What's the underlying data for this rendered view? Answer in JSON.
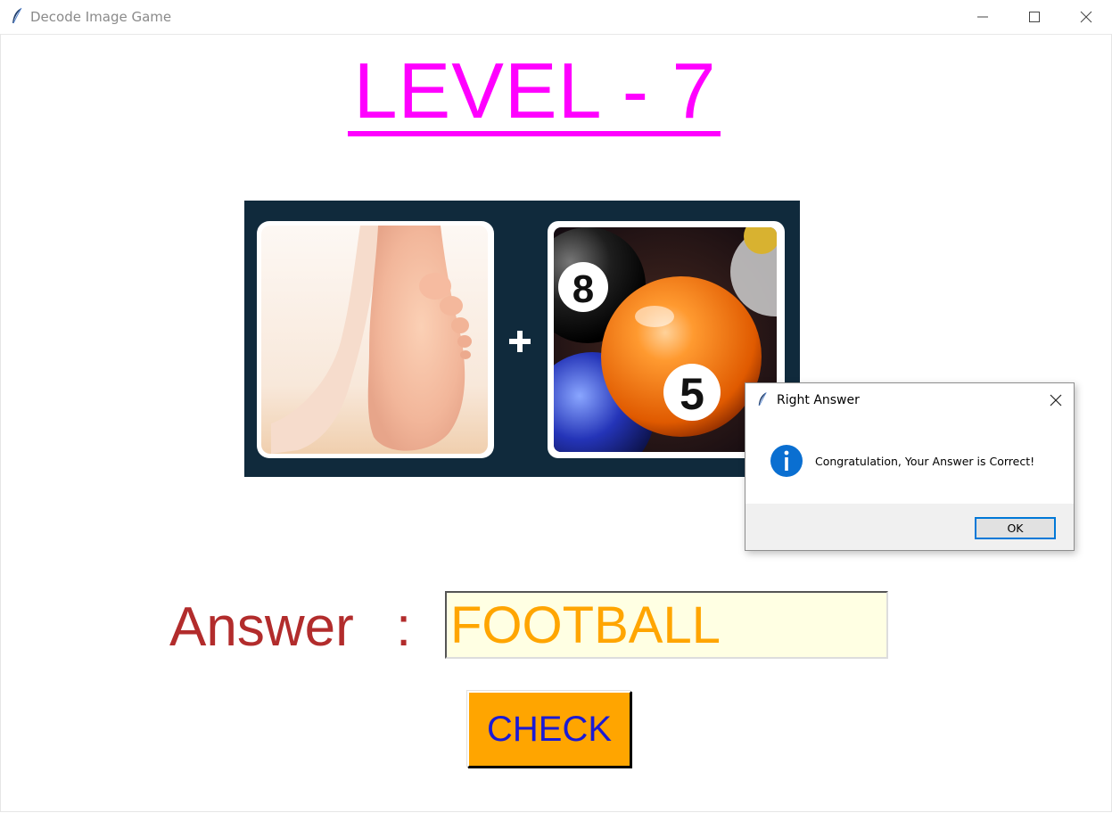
{
  "window": {
    "title": "Decode Image Game"
  },
  "game": {
    "level_title": "LEVEL - 7",
    "puzzle": {
      "left_image": "foot",
      "operator": "+",
      "right_image": "billiard balls"
    },
    "answer_label": "Answer",
    "answer_colon": ":",
    "answer_value": "FOOTBALL",
    "check_label": "CHECK"
  },
  "dialog": {
    "title": "Right Answer",
    "message": "Congratulation, Your Answer is Correct!",
    "ok_label": "OK",
    "icon": "info-icon"
  },
  "colors": {
    "level_title": "#ff00ff",
    "answer_label": "#b22c2c",
    "answer_text": "#ffa500",
    "answer_bg": "#ffffe3",
    "check_bg": "#ffa500",
    "check_text": "#1a1ad6",
    "dialog_accent": "#0078d7"
  }
}
